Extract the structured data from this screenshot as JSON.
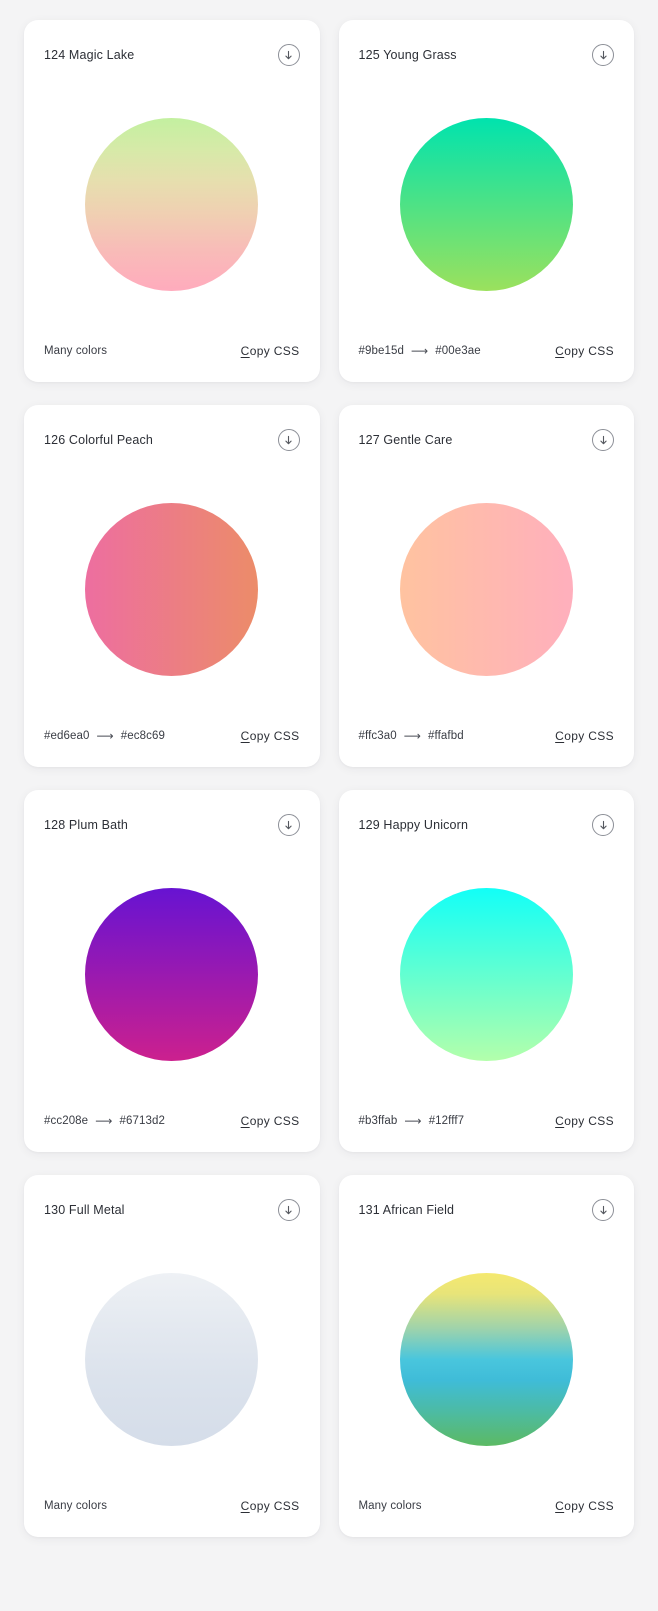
{
  "page": {
    "background": "#f4f4f5",
    "card_background": "#ffffff"
  },
  "labels": {
    "copy_css_accesskey": "C",
    "copy_css_rest": "opy CSS",
    "arrow_glyph": "⟶",
    "many_colors": "Many colors",
    "download_icon": "download-circle-icon"
  },
  "cards": [
    {
      "title": "124 Magic Lake",
      "colors_text": "Many colors",
      "is_many": true,
      "from": "",
      "to": "",
      "gradient": "linear-gradient(180deg, #c3f0a0 0%, #d6eaa8 18%, #e6dfae 36%, #f0cfb2 56%, #f8bcb8 76%, #ffabbd 100%)",
      "copy_css": "Copy CSS"
    },
    {
      "title": "125 Young Grass",
      "colors_text": "#9be15d ⟶ #00e3ae",
      "is_many": false,
      "from": "#9be15d",
      "to": "#00e3ae",
      "gradient": "linear-gradient(180deg, #00e3ae 0%, #9be15d 100%)",
      "copy_css": "Copy CSS"
    },
    {
      "title": "126 Colorful Peach",
      "colors_text": "#ed6ea0 ⟶ #ec8c69",
      "is_many": false,
      "from": "#ed6ea0",
      "to": "#ec8c69",
      "gradient": "linear-gradient(90deg, #ed6ea0 0%, #ec8c69 100%)",
      "copy_css": "Copy CSS"
    },
    {
      "title": "127 Gentle Care",
      "colors_text": "#ffc3a0 ⟶ #ffafbd",
      "is_many": false,
      "from": "#ffc3a0",
      "to": "#ffafbd",
      "gradient": "linear-gradient(90deg, #ffc3a0 0%, #ffafbd 100%)",
      "copy_css": "Copy CSS"
    },
    {
      "title": "128 Plum Bath",
      "colors_text": "#cc208e ⟶ #6713d2",
      "is_many": false,
      "from": "#cc208e",
      "to": "#6713d2",
      "gradient": "linear-gradient(180deg, #6713d2 0%, #cc208e 100%)",
      "copy_css": "Copy CSS"
    },
    {
      "title": "129 Happy Unicorn",
      "colors_text": "#b3ffab ⟶ #12fff7",
      "is_many": false,
      "from": "#b3ffab",
      "to": "#12fff7",
      "gradient": "linear-gradient(180deg, #12fff7 0%, #b3ffab 100%)",
      "copy_css": "Copy CSS"
    },
    {
      "title": "130 Full Metal",
      "colors_text": "Many colors",
      "is_many": true,
      "from": "",
      "to": "",
      "gradient": "linear-gradient(180deg, #eef1f5 0%, #e4e9f0 30%, #dbe2ec 62%, #d5dde9 100%)",
      "copy_css": "Copy CSS"
    },
    {
      "title": "131 African Field",
      "colors_text": "Many colors",
      "is_many": true,
      "from": "",
      "to": "",
      "gradient": "linear-gradient(180deg, #f5e96f 0%, #e8e479 12%, #9fd3ab 32%, #49c6dd 50%, #3fbcd8 62%, #4cbba4 80%, #5cba63 100%)",
      "copy_css": "Copy CSS"
    }
  ]
}
